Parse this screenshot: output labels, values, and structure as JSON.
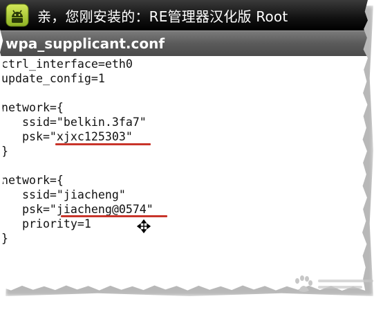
{
  "window": {
    "title": "亲，您刚安装的：RE管理器汉化版 Root",
    "app_icon": "android-icon"
  },
  "file": {
    "name": "wpa_supplicant.conf"
  },
  "code_lines": [
    "ctrl_interface=eth0",
    "update_config=1",
    "",
    "network={",
    "   ssid=\"belkin.3fa7\"",
    "   psk=\"xjxc125303\"",
    "}",
    "",
    "network={",
    "   ssid=\"jiacheng\"",
    "   psk=\"jiacheng@0574\"",
    "   priority=1",
    "}"
  ],
  "highlight_color": "#c8342a",
  "cursor_icon": "move-cursor-icon",
  "watermark": {
    "icon": "baidu-paw-icon"
  }
}
